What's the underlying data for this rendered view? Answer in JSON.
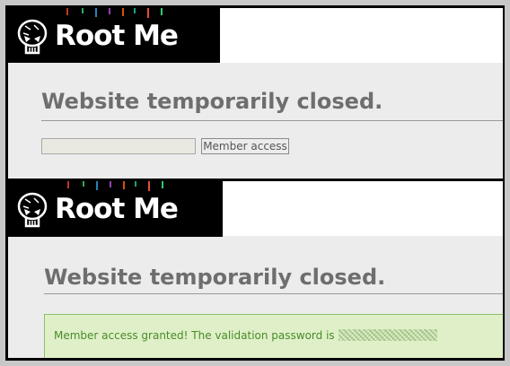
{
  "panels": [
    {
      "logo_text": "Root Me",
      "title": "Website temporarily closed.",
      "password_input": {
        "value": ""
      },
      "member_button_label": "Member access"
    },
    {
      "logo_text": "Root Me",
      "title": "Website temporarily closed.",
      "success_message": "Member access granted! The validation password is"
    }
  ],
  "colors": {
    "title": "#6e6e6e",
    "success_bg": "#dff0c8",
    "success_border": "#8fc06a",
    "success_text": "#4a8a2a"
  }
}
